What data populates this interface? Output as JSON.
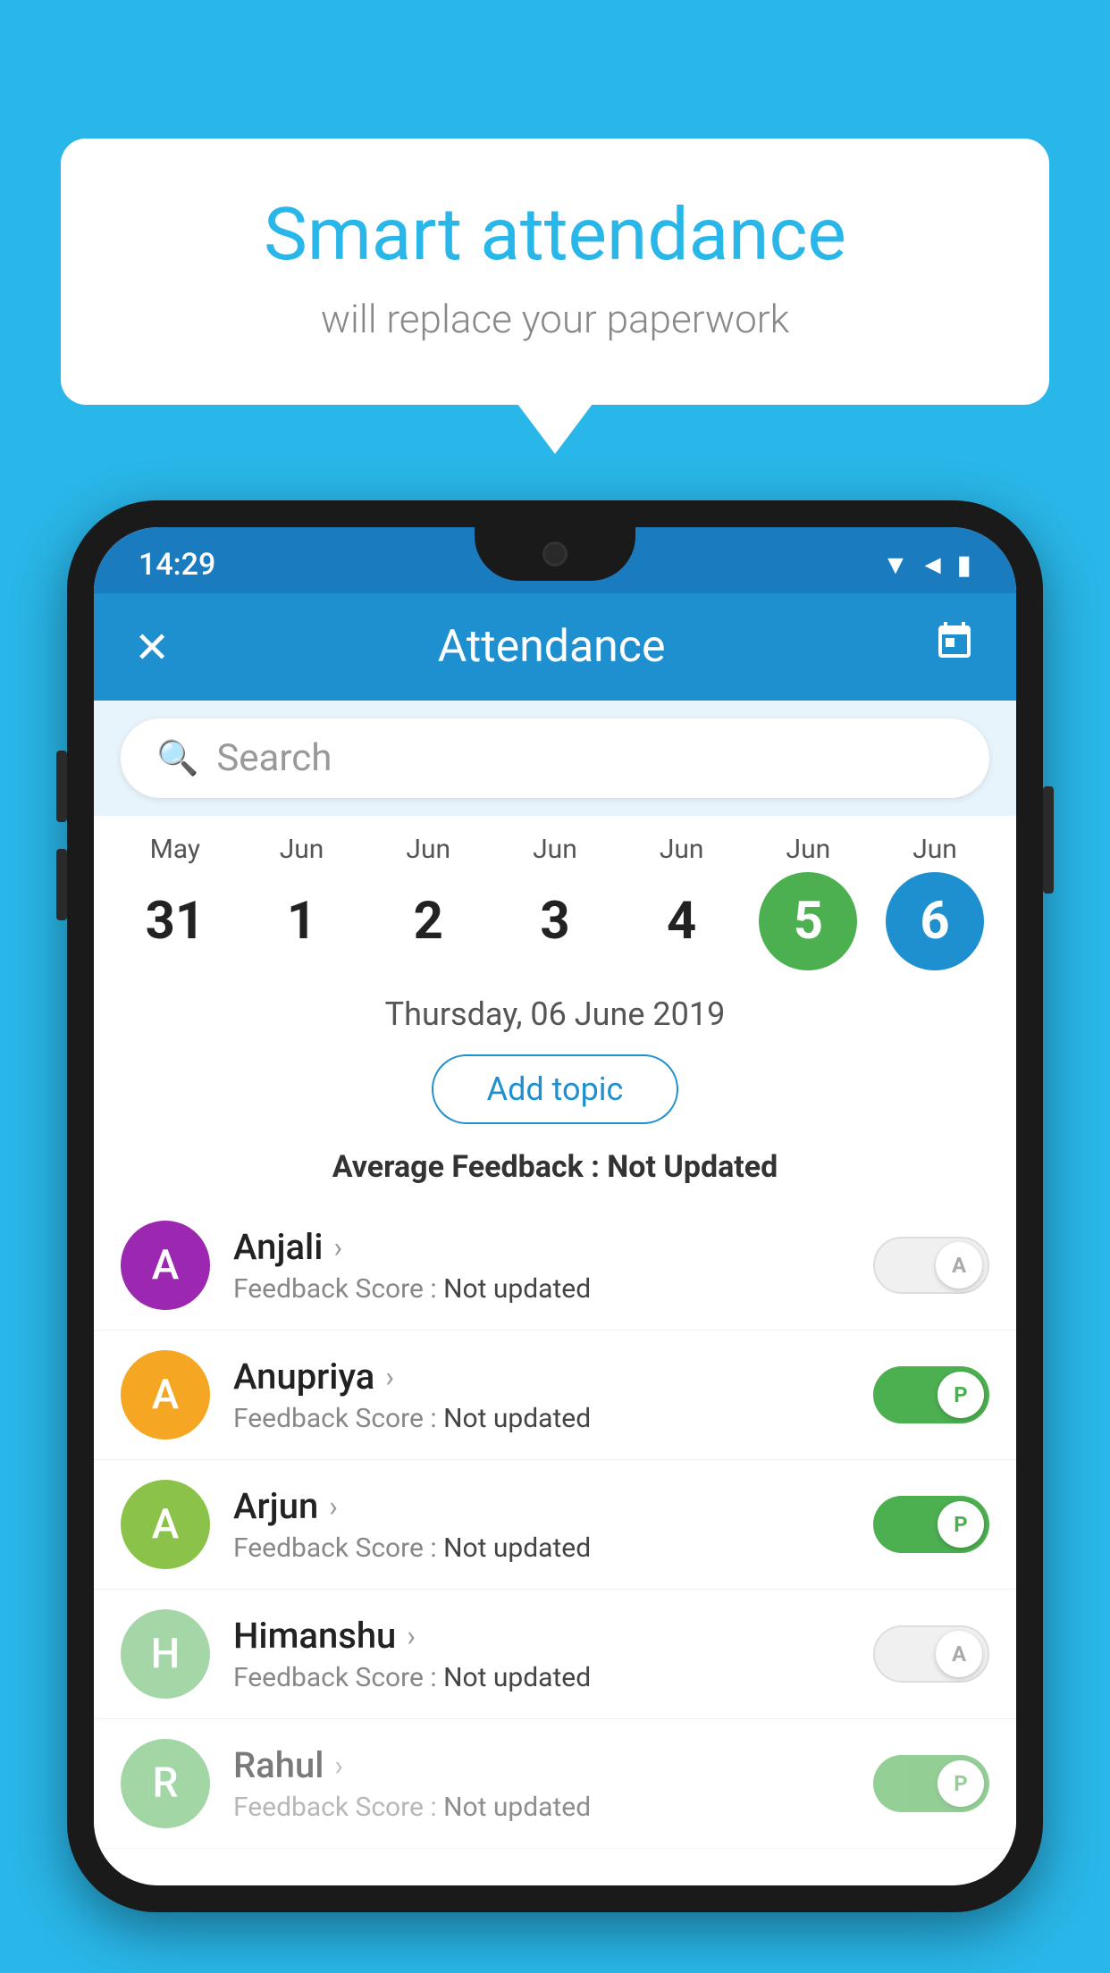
{
  "background_color": "#29b6e8",
  "speech_bubble": {
    "title": "Smart attendance",
    "subtitle": "will replace your paperwork"
  },
  "status_bar": {
    "time": "14:29",
    "wifi": "▼",
    "signal": "▲",
    "battery": "▮"
  },
  "app_bar": {
    "close_label": "✕",
    "title": "Attendance",
    "calendar_label": "📅"
  },
  "search": {
    "placeholder": "Search"
  },
  "calendar": {
    "days": [
      {
        "month": "May",
        "num": "31",
        "state": "normal"
      },
      {
        "month": "Jun",
        "num": "1",
        "state": "normal"
      },
      {
        "month": "Jun",
        "num": "2",
        "state": "normal"
      },
      {
        "month": "Jun",
        "num": "3",
        "state": "normal"
      },
      {
        "month": "Jun",
        "num": "4",
        "state": "normal"
      },
      {
        "month": "Jun",
        "num": "5",
        "state": "today"
      },
      {
        "month": "Jun",
        "num": "6",
        "state": "selected"
      }
    ]
  },
  "selected_date": "Thursday, 06 June 2019",
  "add_topic_label": "Add topic",
  "average_feedback_label": "Average Feedback : ",
  "average_feedback_value": "Not Updated",
  "students": [
    {
      "name": "Anjali",
      "avatar_letter": "A",
      "avatar_color": "#9c27b0",
      "feedback_label": "Feedback Score : ",
      "feedback_value": "Not updated",
      "toggle_state": "off",
      "toggle_label": "A"
    },
    {
      "name": "Anupriya",
      "avatar_letter": "A",
      "avatar_color": "#f5a623",
      "feedback_label": "Feedback Score : ",
      "feedback_value": "Not updated",
      "toggle_state": "on",
      "toggle_label": "P"
    },
    {
      "name": "Arjun",
      "avatar_letter": "A",
      "avatar_color": "#8bc34a",
      "feedback_label": "Feedback Score : ",
      "feedback_value": "Not updated",
      "toggle_state": "on",
      "toggle_label": "P"
    },
    {
      "name": "Himanshu",
      "avatar_letter": "H",
      "avatar_color": "#a5d6a7",
      "feedback_label": "Feedback Score : ",
      "feedback_value": "Not updated",
      "toggle_state": "off",
      "toggle_label": "A"
    },
    {
      "name": "Rahul",
      "avatar_letter": "R",
      "avatar_color": "#66bb6a",
      "feedback_label": "Feedback Score : ",
      "feedback_value": "Not updated",
      "toggle_state": "on",
      "toggle_label": "P"
    }
  ]
}
